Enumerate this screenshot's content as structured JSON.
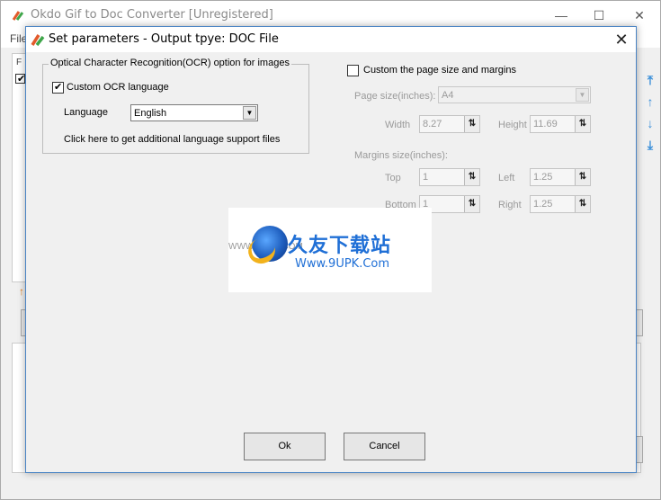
{
  "background_window": {
    "title": "Okdo Gif to Doc Converter [Unregistered]",
    "menu_file": "File",
    "minimize": "—",
    "maximize": "☐",
    "close": "✕",
    "list_header": "F",
    "side_arrows": [
      "⤒",
      "↑",
      "↓",
      "⤓"
    ],
    "orange_arrow": "↑"
  },
  "dialog": {
    "title": "Set parameters - Output tpye: DOC File",
    "close": "✕",
    "ocr_group": {
      "title": "Optical Character Recognition(OCR) option for images",
      "custom_ocr_label": "Custom OCR language",
      "custom_ocr_checked": true,
      "language_label": "Language",
      "language_value": "English",
      "support_link": "Click here to get additional language support files"
    },
    "page": {
      "custom_label": "Custom the page size and margins",
      "custom_checked": false,
      "page_size_label": "Page size(inches):",
      "page_size_value": "A4",
      "width_label": "Width",
      "width_value": "8.27",
      "height_label": "Height",
      "height_value": "11.69",
      "margins_label": "Margins size(inches):",
      "top_label": "Top",
      "top_value": "1",
      "left_label": "Left",
      "left_value": "1.25",
      "bottom_label": "Bottom",
      "bottom_value": "1",
      "right_label": "Right",
      "right_value": "1.25"
    },
    "ok_label": "Ok",
    "cancel_label": "Cancel"
  },
  "watermark": {
    "big_text": "久友下载站",
    "small_text": "Www.9UPK.Com",
    "faint_text": "WWW.9UPK.COM"
  },
  "icons": {
    "spin": "⇅",
    "dropdown": "▼"
  }
}
